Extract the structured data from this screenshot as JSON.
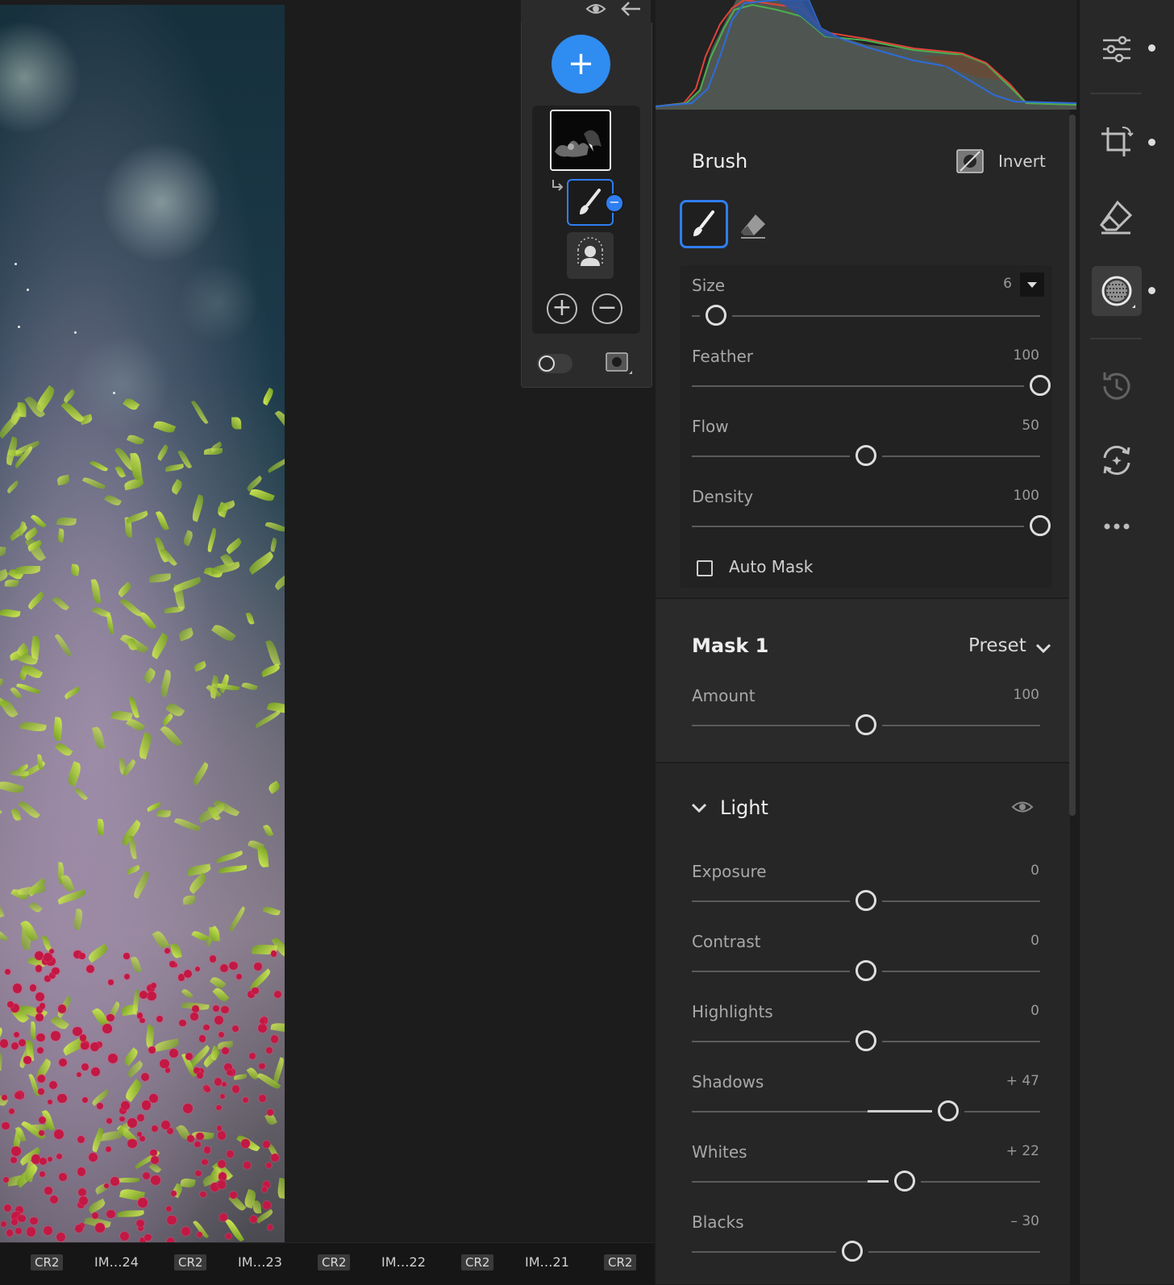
{
  "filmstrip": {
    "items": [
      {
        "label": "CR2",
        "tag": true
      },
      {
        "label": "IM…24",
        "tag": false
      },
      {
        "label": "CR2",
        "tag": true
      },
      {
        "label": "IM…23",
        "tag": false
      },
      {
        "label": "CR2",
        "tag": true
      },
      {
        "label": "IM…22",
        "tag": false
      },
      {
        "label": "CR2",
        "tag": true
      },
      {
        "label": "IM…21",
        "tag": false
      },
      {
        "label": "CR2",
        "tag": true
      }
    ]
  },
  "masks_panel": {
    "add_label": "+",
    "add_symbol": "+",
    "subtract_symbol": "−",
    "subtract_badge": "−"
  },
  "brush": {
    "title": "Brush",
    "invert_label": "Invert",
    "size": {
      "label": "Size",
      "value": "6",
      "fraction": 0.07
    },
    "feather": {
      "label": "Feather",
      "value": "100",
      "fraction": 1.0
    },
    "flow": {
      "label": "Flow",
      "value": "50",
      "fraction": 0.5
    },
    "density": {
      "label": "Density",
      "value": "100",
      "fraction": 1.0
    },
    "auto_mask": {
      "label": "Auto Mask",
      "checked": false
    }
  },
  "mask": {
    "title": "Mask 1",
    "preset_label": "Preset",
    "amount": {
      "label": "Amount",
      "value": "100",
      "fraction": 0.5
    }
  },
  "light": {
    "title": "Light",
    "sliders": [
      {
        "label": "Exposure",
        "value": "0",
        "fraction": 0.5,
        "fill": 0
      },
      {
        "label": "Contrast",
        "value": "0",
        "fraction": 0.5,
        "fill": 0
      },
      {
        "label": "Highlights",
        "value": "0",
        "fraction": 0.5,
        "fill": 0
      },
      {
        "label": "Shadows",
        "value": "+ 47",
        "fraction": 0.735,
        "fill": 0.47
      },
      {
        "label": "Whites",
        "value": "+ 22",
        "fraction": 0.61,
        "fill": 0.22
      },
      {
        "label": "Blacks",
        "value": "– 30",
        "fraction": 0.46,
        "fill": -0.3
      }
    ]
  },
  "colors": {
    "accent": "#2f8cf0",
    "histogram_red": "#e0443a",
    "histogram_green": "#4caf50",
    "histogram_blue": "#2e6bd8"
  }
}
